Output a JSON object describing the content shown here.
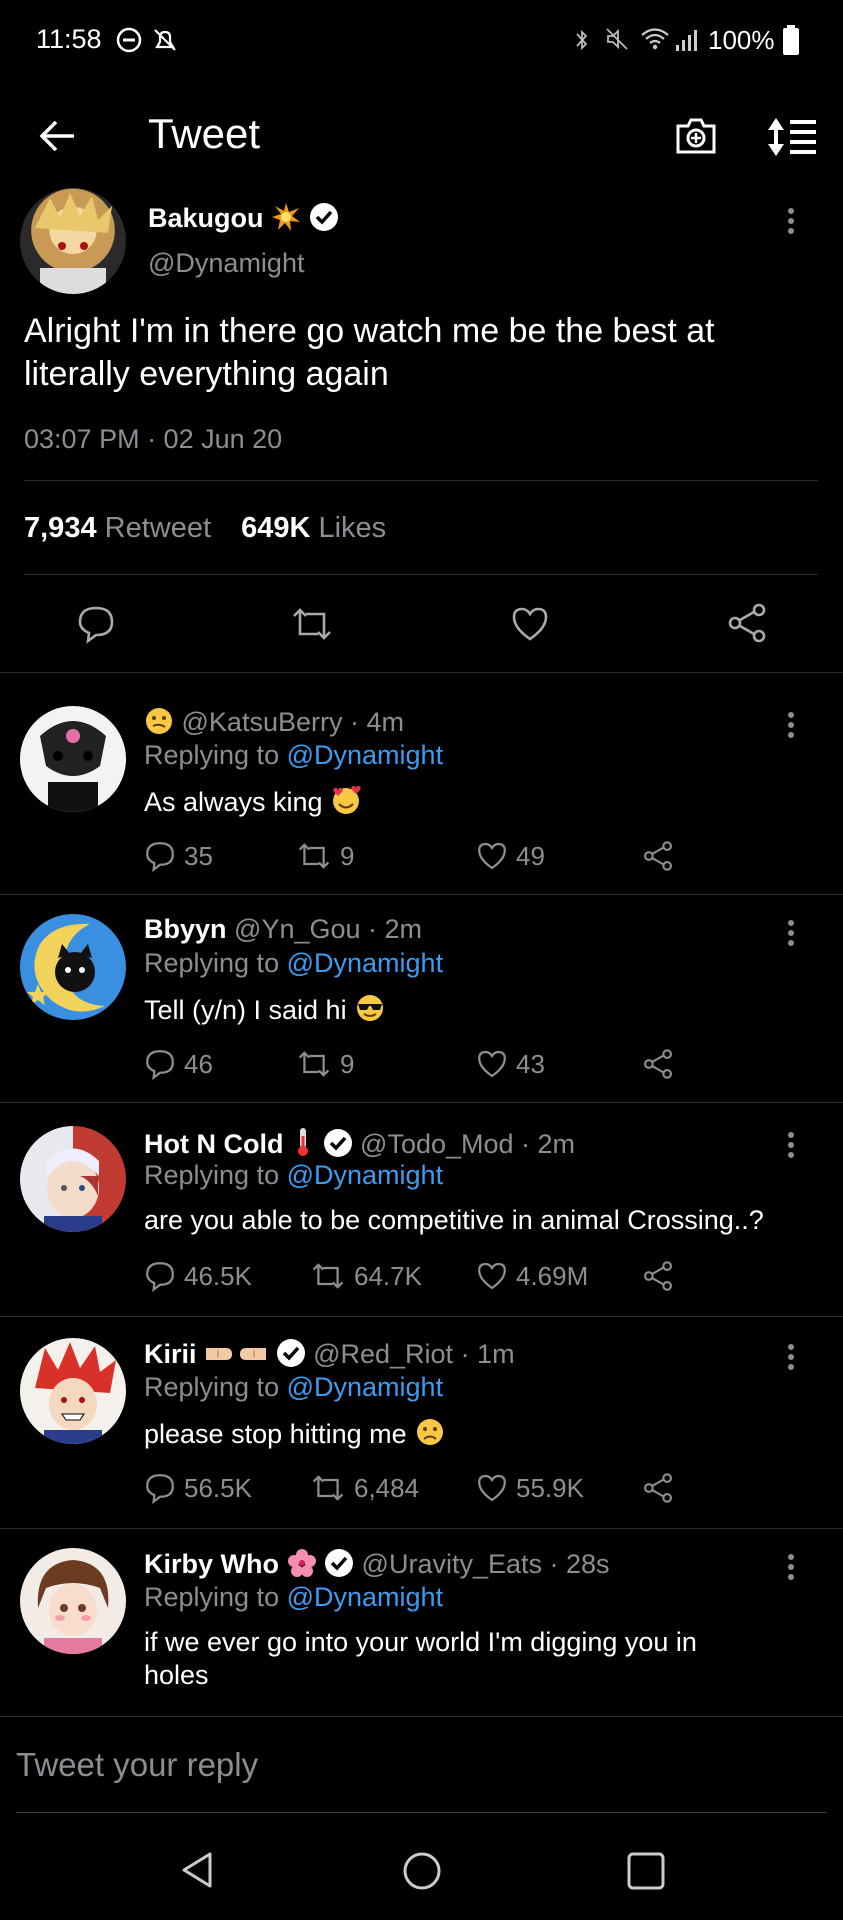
{
  "status_bar": {
    "time": "11:58",
    "battery": "100%",
    "icons": [
      "do-not-disturb-icon",
      "notification-off-icon",
      "bluetooth-icon",
      "mute-icon",
      "wifi-icon",
      "signal-icon",
      "battery-icon"
    ]
  },
  "header": {
    "title": "Tweet",
    "icons": [
      "back-arrow-icon",
      "camera-icon",
      "sort-icon"
    ]
  },
  "main_tweet": {
    "display_name": "Bakugou",
    "handle": "@Dynamight",
    "text": "Alright I'm in there go watch me be the best at literally everything again",
    "timestamp": "03:07 PM · 02 Jun 20",
    "retweet_count": "7,934",
    "retweet_label": "Retweet",
    "like_count": "649K",
    "like_label": "Likes"
  },
  "replies": [
    {
      "display_name": "",
      "handle": "@KatsuBerry",
      "time": "· 4m",
      "replying_prefix": "Replying to",
      "replying_handle": "@Dynamight",
      "text": "As always king",
      "comments": "35",
      "retweets": "9",
      "likes": "49"
    },
    {
      "display_name": "Bbyyn",
      "handle": "@Yn_Gou",
      "time": "· 2m",
      "replying_prefix": "Replying to",
      "replying_handle": "@Dynamight",
      "text": "Tell (y/n) I said hi",
      "comments": "46",
      "retweets": "9",
      "likes": "43"
    },
    {
      "display_name": "Hot N Cold",
      "handle": "@Todo_Mod",
      "time": "· 2m",
      "replying_prefix": "Replying to",
      "replying_handle": "@Dynamight",
      "text": "are you able to be competitive in animal Crossing..?",
      "comments": "46.5K",
      "retweets": "64.7K",
      "likes": "4.69M"
    },
    {
      "display_name": "Kirii",
      "handle": "@Red_Riot",
      "time": "· 1m",
      "replying_prefix": "Replying to",
      "replying_handle": "@Dynamight",
      "text": "please stop hitting me",
      "comments": "56.5K",
      "retweets": "6,484",
      "likes": "55.9K"
    },
    {
      "display_name": "Kirby Who",
      "handle": "@Uravity_Eats",
      "time": "· 28s",
      "replying_prefix": "Replying to",
      "replying_handle": "@Dynamight",
      "text": "if we ever go into your world I'm digging you in holes"
    }
  ],
  "composer": {
    "placeholder": "Tweet your reply"
  },
  "nav_bar": {
    "icons": [
      "back-triangle-icon",
      "home-circle-icon",
      "recents-square-icon"
    ]
  },
  "colors": {
    "background": "#000000",
    "accent": "#3d9bf0",
    "muted": "#8b8f94",
    "divider": "#2b2f33"
  }
}
